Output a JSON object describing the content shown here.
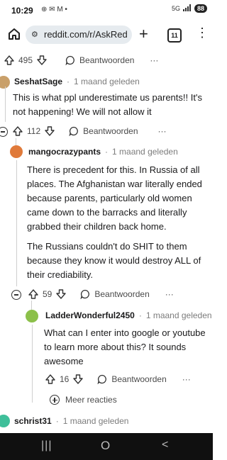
{
  "status": {
    "time": "10:29",
    "notif_icons": "⊕ ✉ M •",
    "signal_label": "5G",
    "battery": "88"
  },
  "browser": {
    "url": "reddit.com/r/AskRedd",
    "tab_count": "11"
  },
  "top_row": {
    "votes": "495",
    "reply_label": "Beantwoorden",
    "more": "···"
  },
  "comments": [
    {
      "author": "SeshatSage",
      "time": "1 maand geleden",
      "text": "This is what ppl underestimate us parents!! It's not happening! We will not allow it",
      "votes": "112",
      "reply_label": "Beantwoorden",
      "more": "···"
    },
    {
      "author": "mangocrazypants",
      "time": "1 maand geleden",
      "text_p1": "There is precedent for this. In Russia of all places. The Afghanistan war literally ended because parents, particularly old women came down to the barracks and literally grabbed their children back home.",
      "text_p2": "The Russians couldn't do SHIT to them because they know it would destroy ALL of their crediability.",
      "votes": "59",
      "reply_label": "Beantwoorden",
      "more": "···"
    },
    {
      "author": "LadderWonderful2450",
      "time": "1 maand geleden",
      "text": "What can I enter into google or youtube to learn more about this? It sounds awesome",
      "votes": "16",
      "reply_label": "Beantwoorden",
      "more": "···"
    },
    {
      "author": "schrist31",
      "time": "1 maand geleden"
    }
  ],
  "more_replies": "Meer reacties",
  "dot_sep": "·",
  "nav": {
    "recents": "|||",
    "home": "O",
    "back": "<"
  },
  "colors": {
    "navbar": "#101010",
    "thread_line": "#cfcfcf"
  }
}
